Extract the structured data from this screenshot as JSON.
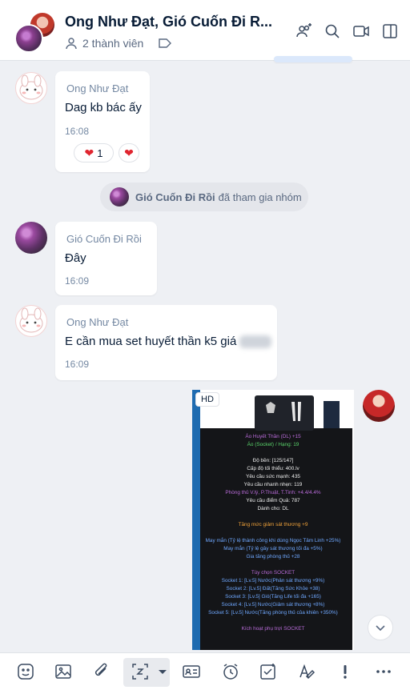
{
  "header": {
    "title": "Ong Như Đạt, Gió Cuốn Đi R...",
    "members_label": "2 thành viên"
  },
  "messages": [
    {
      "sender": "Ong Như Đạt",
      "text": "Dag kb bác ấy",
      "time": "16:08",
      "reaction_count": "1"
    },
    {
      "sender": "Gió Cuốn Đi Rồi",
      "text": "Đây",
      "time": "16:09"
    },
    {
      "sender": "Ong Như Đạt",
      "text": "E cần mua set huyết thần k5 giá",
      "time": "16:09"
    }
  ],
  "system_message": {
    "name": "Gió Cuốn Đi Rồi",
    "text": "đã tham gia nhóm"
  },
  "image_message": {
    "badge": "HD",
    "lines": [
      {
        "text": "Áo Huyết Thần (DL) +15",
        "color": "purple"
      },
      {
        "text": "Áo (Socket) / Hạng: 19",
        "color": "green"
      },
      {
        "text": "",
        "color": "white"
      },
      {
        "text": "Độ bền: [125/147]",
        "color": "white"
      },
      {
        "text": "Cấp độ tối thiểu: 400.lv",
        "color": "white"
      },
      {
        "text": "Yêu cầu sức mạnh: 435",
        "color": "white"
      },
      {
        "text": "Yêu cầu nhanh nhẹn: 119",
        "color": "white"
      },
      {
        "text": "Phòng thủ V.lý, P.Thuật, T.Tinh: +4.4/4.4%",
        "color": "purple"
      },
      {
        "text": "Yêu cầu điểm Quả: 787",
        "color": "white"
      },
      {
        "text": "Dành cho: DL",
        "color": "white"
      },
      {
        "text": "",
        "color": "white"
      },
      {
        "text": "Tăng mức giảm sát thương +9",
        "color": "orange"
      },
      {
        "text": "",
        "color": "white"
      },
      {
        "text": "May mắn (Tỷ lệ thành công khi dùng Ngọc Tâm Linh +25%)",
        "color": "blue"
      },
      {
        "text": "May mắn (Tỷ lệ gây sát thương tối đa +5%)",
        "color": "blue"
      },
      {
        "text": "Gia tăng phòng thủ +28",
        "color": "blue"
      },
      {
        "text": "",
        "color": "white"
      },
      {
        "text": "Tùy chọn SOCKET",
        "color": "purple"
      },
      {
        "text": "Socket 1: [Lv.5] Nước(Phản sát thương +9%)",
        "color": "blue"
      },
      {
        "text": "Socket 2: [Lv.5] Đất(Tăng Sức Khỏe +38)",
        "color": "blue"
      },
      {
        "text": "Socket 3: [Lv.5] Gió(Tăng Life tối đa +165)",
        "color": "blue"
      },
      {
        "text": "Socket 4: [Lv.5] Nước(Giảm sát thương +8%)",
        "color": "blue"
      },
      {
        "text": "Socket 5: [Lv.5] Nước(Tăng phòng thủ của khiên +350%)",
        "color": "blue"
      },
      {
        "text": "",
        "color": "white"
      },
      {
        "text": "Kích hoạt phụ trợi SOCKET",
        "color": "purple"
      }
    ]
  },
  "colors": {
    "accent": "#0068ff",
    "background": "#eef0f4",
    "bubble": "#ffffff",
    "heart": "#e0252f"
  },
  "toolbar": {
    "icons": [
      "sticker-icon",
      "image-icon",
      "attachment-icon",
      "screenshot-icon",
      "contact-card-icon",
      "reminder-icon",
      "task-icon",
      "format-icon",
      "urgent-icon",
      "more-icon"
    ]
  }
}
